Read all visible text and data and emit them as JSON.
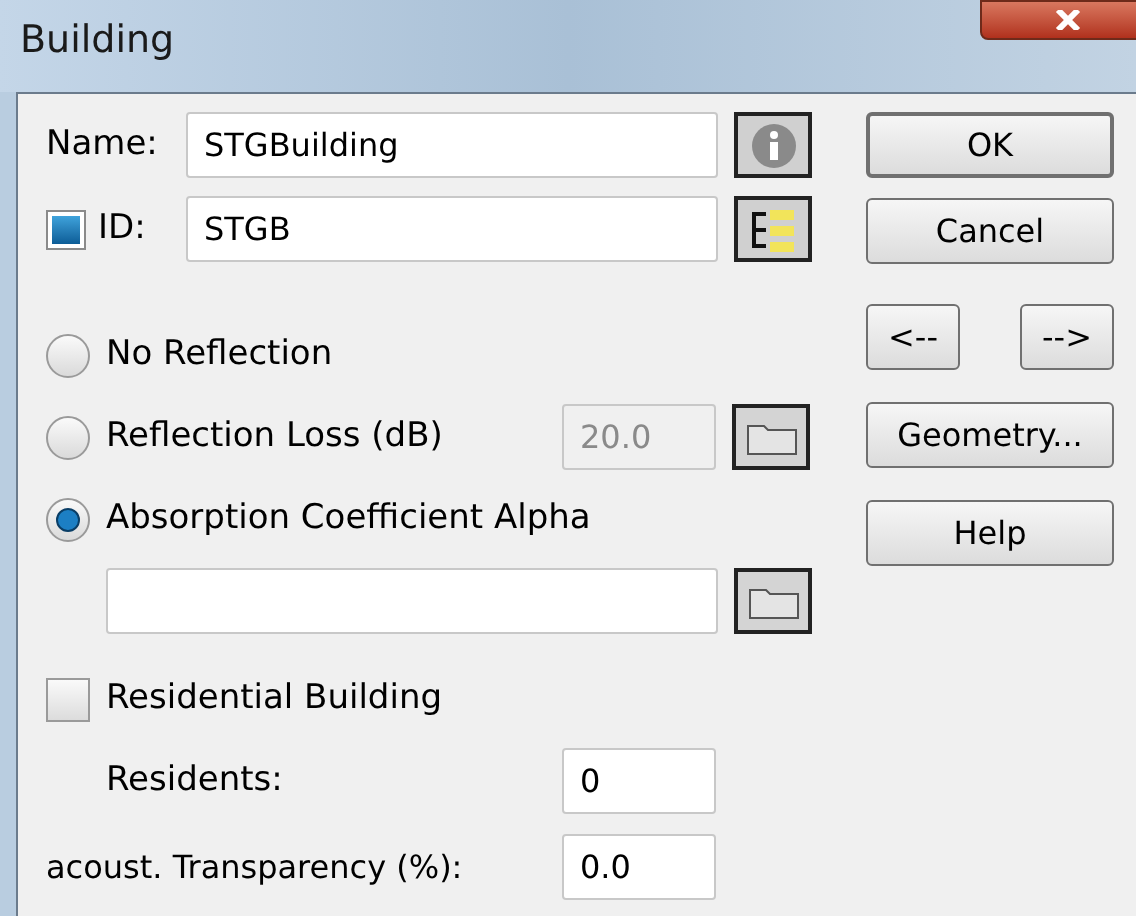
{
  "window": {
    "title": "Building"
  },
  "name_field": {
    "label": "Name:",
    "value": "STGBuilding"
  },
  "id_field": {
    "checked": true,
    "label": "ID:",
    "value": "STGB"
  },
  "reflection_options": [
    {
      "label": "No Reflection",
      "selected": false
    },
    {
      "label": "Reflection Loss (dB)",
      "selected": false,
      "value": "20.0",
      "disabled": true
    },
    {
      "label": "Absorption Coefficient Alpha",
      "selected": true
    }
  ],
  "residential": {
    "label": "Residential Building",
    "checked": false
  },
  "residents": {
    "label": "Residents:",
    "value": "0"
  },
  "transparency": {
    "label": "acoust. Transparency (%):",
    "value": "0.0"
  },
  "buttons": {
    "ok": "OK",
    "cancel": "Cancel",
    "prev": "<--",
    "next": "-->",
    "geometry": "Geometry...",
    "help": "Help"
  }
}
